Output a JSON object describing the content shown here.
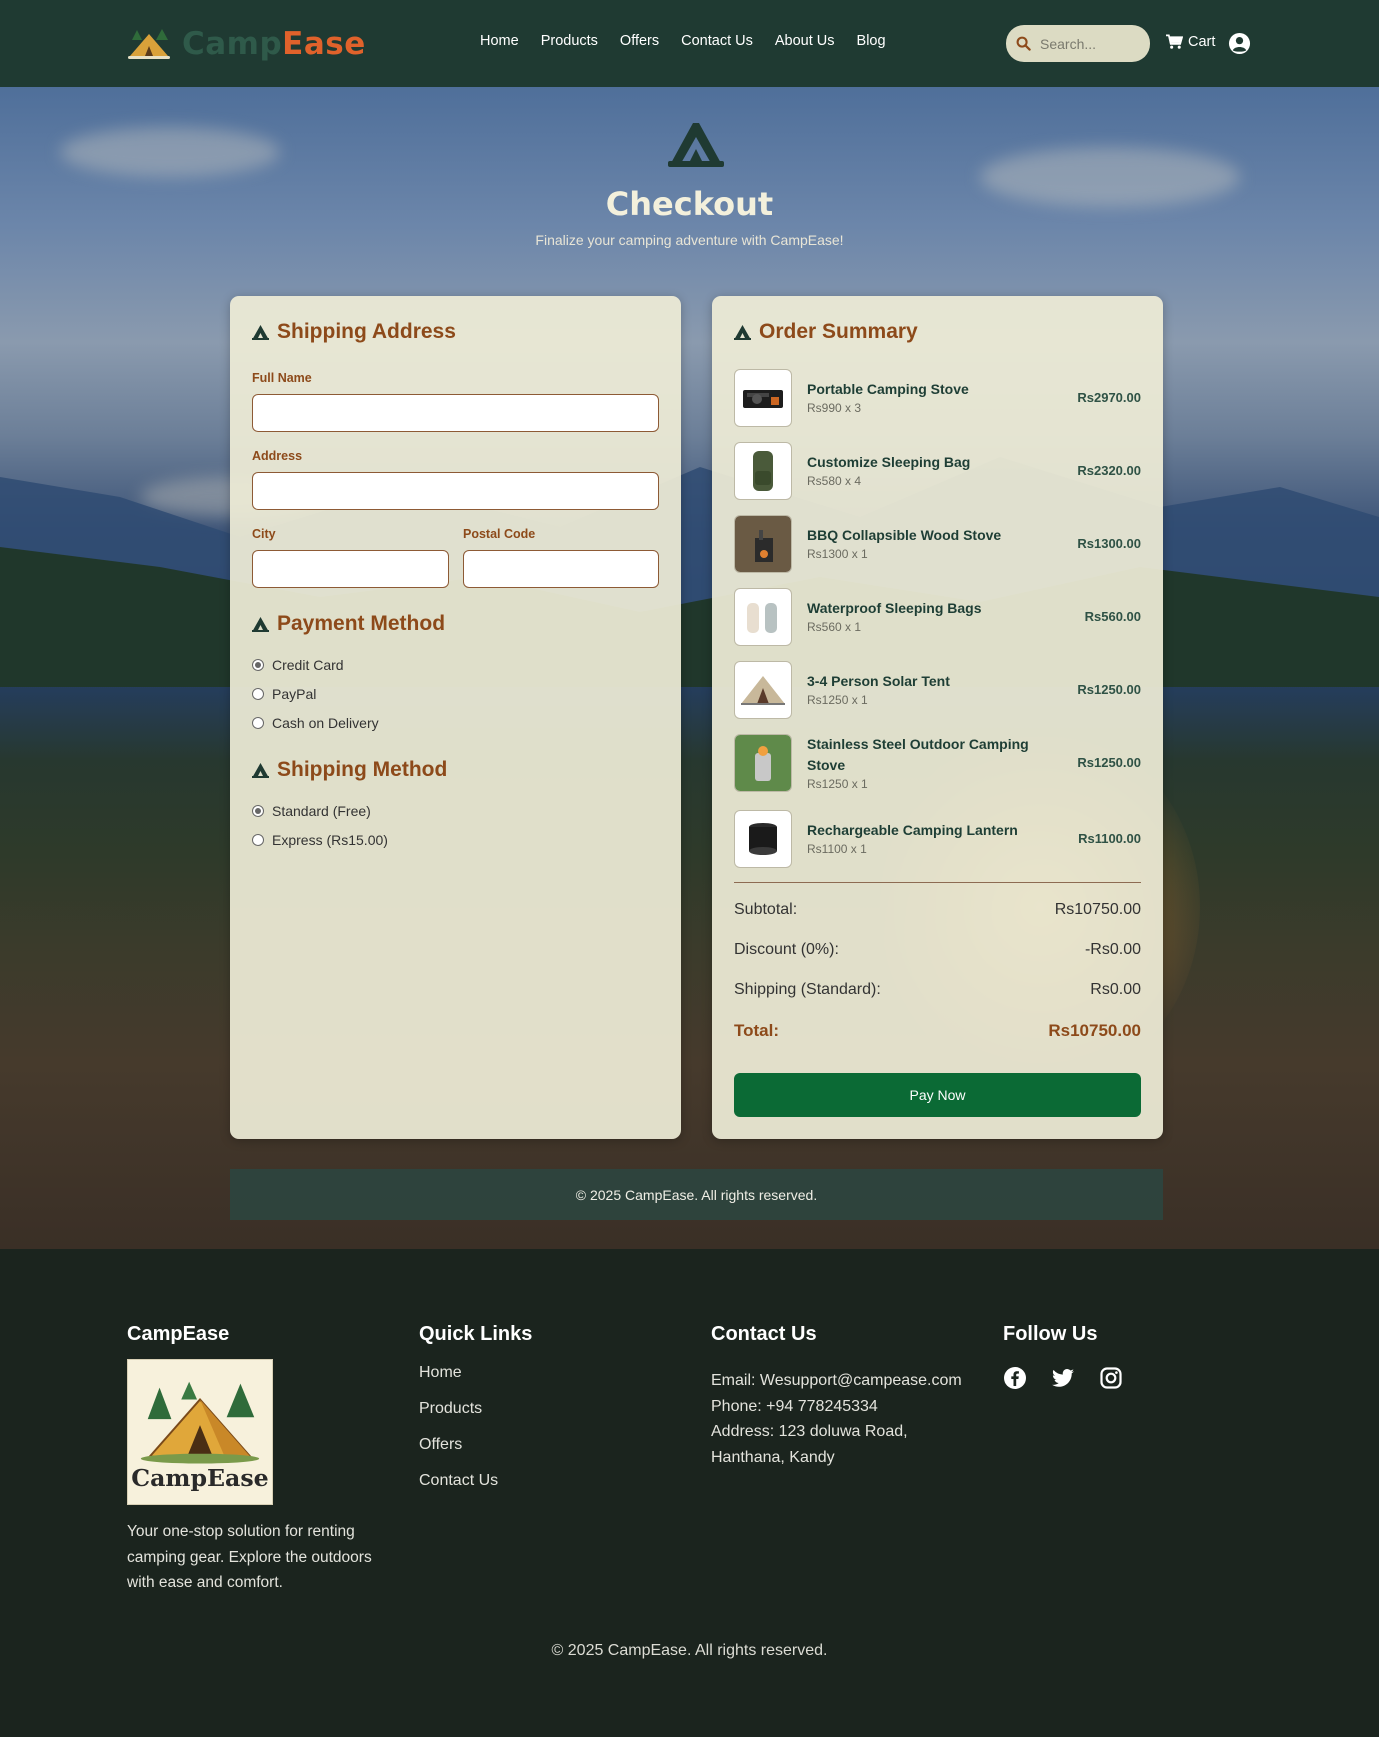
{
  "header": {
    "brand": {
      "part1": "Camp",
      "part2": "Ease"
    },
    "nav": [
      "Home",
      "Products",
      "Offers",
      "Contact Us",
      "About Us",
      "Blog"
    ],
    "search": {
      "placeholder": "Search..."
    },
    "cart_label": "Cart",
    "icons": {
      "logo": "tent-logo-icon",
      "search": "search-icon",
      "cart": "cart-icon",
      "user": "user-circle-icon"
    }
  },
  "hero": {
    "title": "Checkout",
    "subtitle": "Finalize your camping adventure with CampEase!",
    "icon": "tent-icon"
  },
  "shipping": {
    "heading": "Shipping Address",
    "full_name_label": "Full Name",
    "full_name_value": "",
    "address_label": "Address",
    "address_value": "",
    "city_label": "City",
    "city_value": "",
    "postal_label": "Postal Code",
    "postal_value": ""
  },
  "payment": {
    "heading": "Payment Method",
    "options": [
      {
        "label": "Credit Card",
        "selected": true
      },
      {
        "label": "PayPal",
        "selected": false
      },
      {
        "label": "Cash on Delivery",
        "selected": false
      }
    ]
  },
  "shipping_method": {
    "heading": "Shipping Method",
    "options": [
      {
        "label": "Standard (Free)",
        "selected": true
      },
      {
        "label": "Express (Rs15.00)",
        "selected": false
      }
    ]
  },
  "order": {
    "heading": "Order Summary",
    "items": [
      {
        "name": "Portable Camping Stove",
        "meta": "Rs990 x 3",
        "price": "Rs2970.00",
        "image": "camping-stove-image"
      },
      {
        "name": "Customize Sleeping Bag",
        "meta": "Rs580 x 4",
        "price": "Rs2320.00",
        "image": "sleeping-bag-image"
      },
      {
        "name": "BBQ Collapsible Wood Stove",
        "meta": "Rs1300 x 1",
        "price": "Rs1300.00",
        "image": "wood-stove-image"
      },
      {
        "name": "Waterproof Sleeping Bags",
        "meta": "Rs560 x 1",
        "price": "Rs560.00",
        "image": "waterproof-bags-image"
      },
      {
        "name": "3-4 Person Solar Tent",
        "meta": "Rs1250 x 1",
        "price": "Rs1250.00",
        "image": "solar-tent-image"
      },
      {
        "name": "Stainless Steel Outdoor Camping Stove",
        "meta": "Rs1250 x 1",
        "price": "Rs1250.00",
        "image": "steel-stove-image"
      },
      {
        "name": "Rechargeable Camping Lantern",
        "meta": "Rs1100 x 1",
        "price": "Rs1100.00",
        "image": "lantern-image"
      }
    ],
    "subtotal_label": "Subtotal:",
    "subtotal": "Rs10750.00",
    "discount_label": "Discount (0%):",
    "discount": "-Rs0.00",
    "shipping_label": "Shipping (Standard):",
    "shipping": "Rs0.00",
    "total_label": "Total:",
    "total": "Rs10750.00",
    "pay_button": "Pay Now"
  },
  "inner_footer": "© 2025 CampEase. All rights reserved.",
  "footer": {
    "brand_heading": "CampEase",
    "logo_text": "CampEase",
    "description": "Your one-stop solution for renting camping gear. Explore the outdoors with ease and comfort.",
    "quick_links_heading": "Quick Links",
    "quick_links": [
      "Home",
      "Products",
      "Offers",
      "Contact Us"
    ],
    "contact_heading": "Contact Us",
    "email": "Email: Wesupport@campease.com",
    "phone": "Phone: +94 778245334",
    "address": "Address: 123 doluwa Road, Hanthana, Kandy",
    "follow_heading": "Follow Us",
    "social_icons": [
      "facebook-icon",
      "twitter-icon",
      "instagram-icon"
    ],
    "copyright": "© 2025 CampEase. All rights reserved."
  },
  "colors": {
    "header_bg": "#1f3a32",
    "accent": "#8d4a1a",
    "pay_button": "#0b6a35",
    "footer_bg": "#1b241e"
  }
}
